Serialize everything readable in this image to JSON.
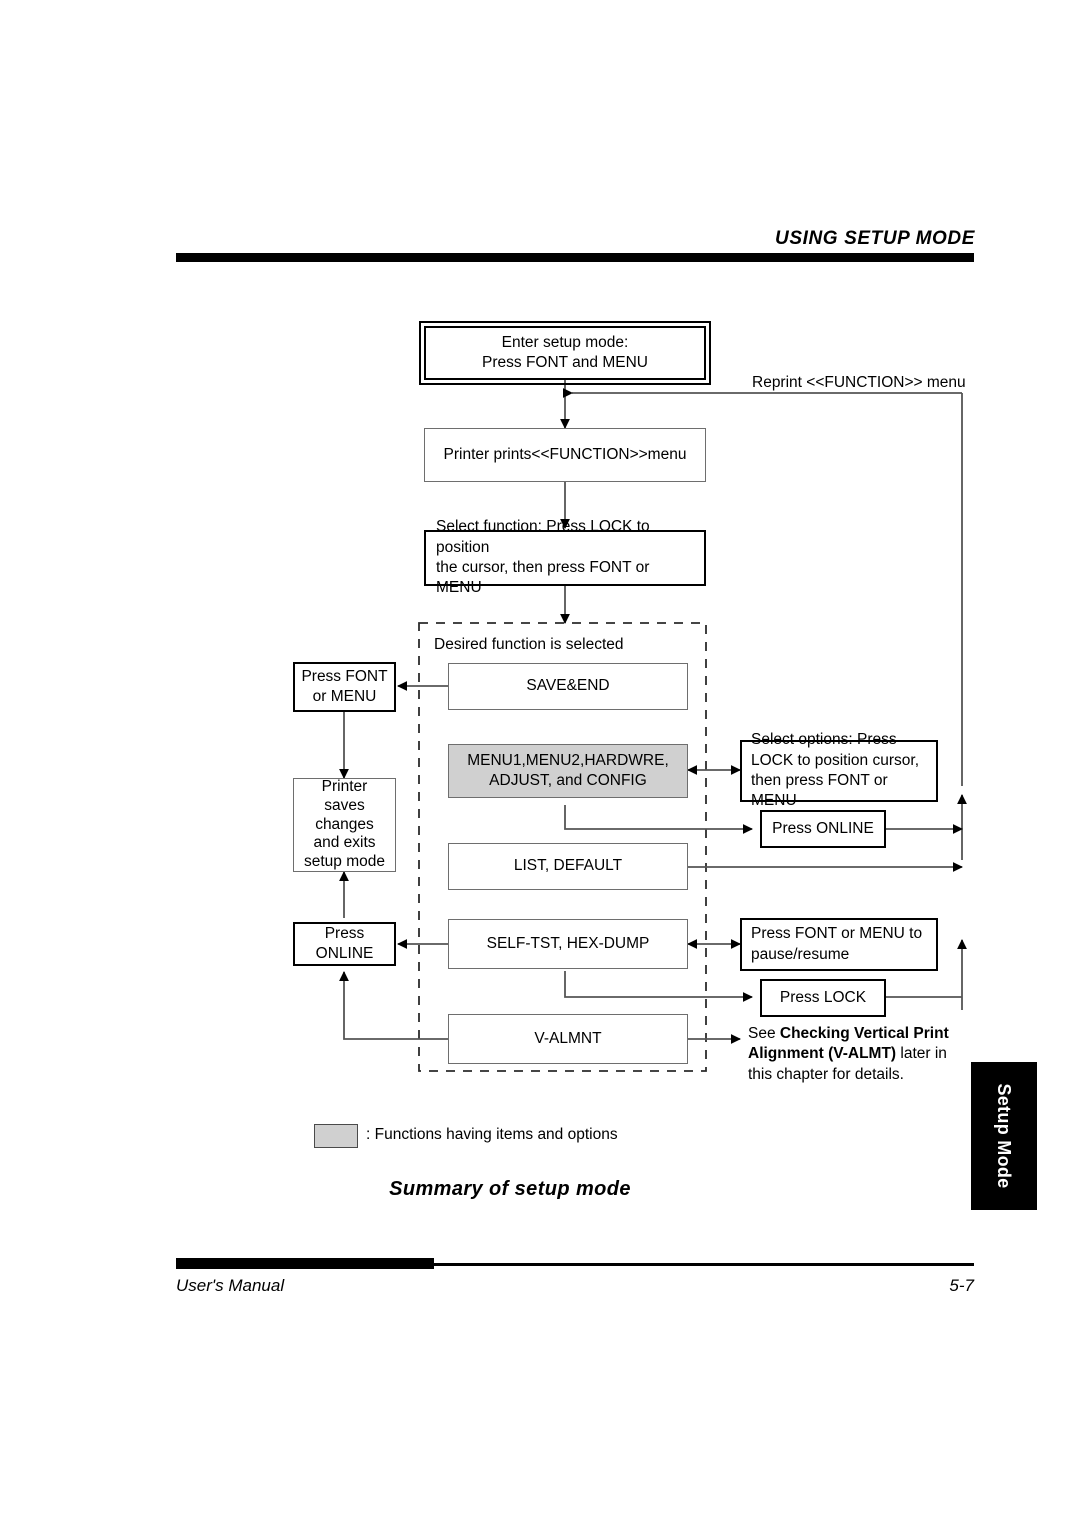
{
  "header": {
    "title": "USING SETUP MODE"
  },
  "footer": {
    "left": "User's Manual",
    "page": "5-7"
  },
  "side_tab": {
    "label": "Setup Mode"
  },
  "caption": {
    "text": "Summary of setup mode"
  },
  "legend": {
    "text": ": Functions having items and options",
    "swatch_color": "#d0d0d0"
  },
  "chart_data": {
    "type": "diagram",
    "title": "Summary of setup mode",
    "nodes": [
      {
        "id": "enter",
        "label": "Enter setup mode:\nPress FONT and MENU",
        "style": "double-border"
      },
      {
        "id": "prints",
        "label": "Printer prints<<FUNCTION>>menu",
        "style": "thin-border"
      },
      {
        "id": "select",
        "label": "Select function: Press LOCK to position\nthe cursor, then press FONT or MENU",
        "style": "thick-border"
      },
      {
        "id": "save_end",
        "label": "SAVE&END",
        "style": "thin-border"
      },
      {
        "id": "menus",
        "label": "MENU1,MENU2,HARDWRE,\nADJUST, and CONFIG",
        "style": "gray-fill"
      },
      {
        "id": "list_default",
        "label": "LIST, DEFAULT",
        "style": "thin-border"
      },
      {
        "id": "self_test",
        "label": "SELF-TST, HEX-DUMP",
        "style": "thin-border"
      },
      {
        "id": "valmnt",
        "label": "V-ALMNT",
        "style": "thin-border"
      },
      {
        "id": "press_font",
        "label": "Press FONT\nor MENU",
        "style": "thick-border"
      },
      {
        "id": "printer_saves",
        "label": "Printer\nsaves\nchanges\nand exits\nsetup mode",
        "style": "thin-border"
      },
      {
        "id": "press_online_left",
        "label": "Press ONLINE",
        "style": "thick-border"
      },
      {
        "id": "select_options",
        "label": "Select options:  Press\nLOCK to position cursor,\nthen press FONT or MENU",
        "style": "thick-border"
      },
      {
        "id": "press_online_right",
        "label": "Press ONLINE",
        "style": "thick-border"
      },
      {
        "id": "pause_resume",
        "label": "Press FONT or MENU to\npause/resume",
        "style": "thick-border"
      },
      {
        "id": "press_lock",
        "label": "Press LOCK",
        "style": "thick-border"
      }
    ],
    "group_label": "Desired function is selected",
    "edge_labels": [
      "Reprint <<FUNCTION>> menu"
    ],
    "annotation": {
      "prefix": "See ",
      "bold1": "Checking Vertical Print",
      "bold2": "Alignment (V-ALMT)",
      "mid": " later in",
      "suffix": "this chapter for details."
    }
  },
  "nodes": {
    "enter": {
      "line1": "Enter setup mode:",
      "line2": "Press FONT and MENU"
    },
    "prints": {
      "label": "Printer prints<<FUNCTION>>menu"
    },
    "select": {
      "line1": "Select function: Press LOCK to position",
      "line2": "the cursor, then press FONT or MENU"
    },
    "group_label": {
      "text": "Desired function is selected"
    },
    "save_end": {
      "label": "SAVE&END"
    },
    "menus": {
      "line1": "MENU1,MENU2,HARDWRE,",
      "line2": "ADJUST, and CONFIG"
    },
    "list_default": {
      "label": "LIST, DEFAULT"
    },
    "self_test": {
      "label": "SELF-TST, HEX-DUMP"
    },
    "valmnt": {
      "label": "V-ALMNT"
    },
    "press_font": {
      "line1": "Press FONT",
      "line2": "or MENU"
    },
    "printer_saves": {
      "line1": "Printer",
      "line2": "saves",
      "line3": "changes",
      "line4": "and exits",
      "line5": "setup mode"
    },
    "press_online_left": {
      "label": "Press ONLINE"
    },
    "select_options": {
      "line1": "Select options:  Press",
      "line2": "LOCK to position cursor,",
      "line3": "then press FONT or MENU"
    },
    "press_online_right": {
      "label": "Press ONLINE"
    },
    "pause_resume": {
      "line1": "Press FONT or MENU to",
      "line2": "pause/resume"
    },
    "press_lock": {
      "label": "Press LOCK"
    }
  },
  "labels": {
    "reprint": "Reprint <<FUNCTION>> menu"
  },
  "annotation": {
    "prefix": "See ",
    "bold1": "Checking Vertical Print",
    "bold2": "Alignment (V-ALMT)",
    "mid": " later in",
    "suffix": "this chapter for details."
  }
}
